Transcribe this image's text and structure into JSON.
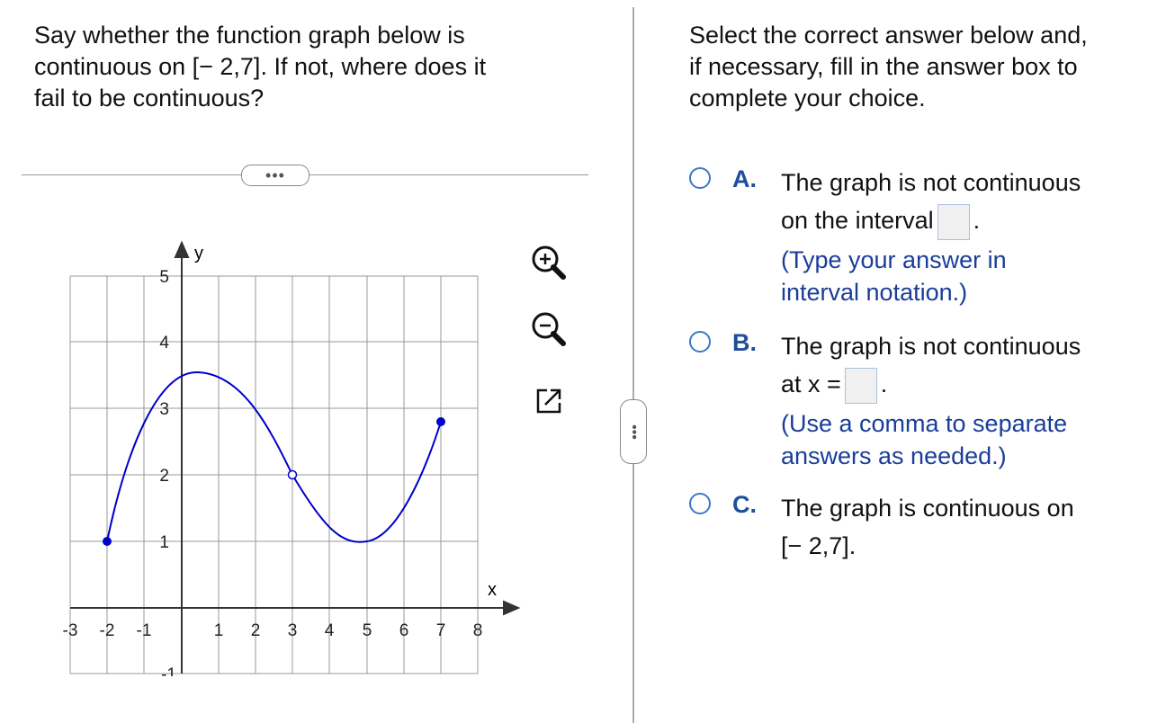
{
  "question": {
    "line1": "Say whether the function graph below is",
    "line2": "continuous on [− 2,7]. If not, where does it",
    "line3": "fail to be continuous?"
  },
  "more_label": "•••",
  "graph": {
    "x_axis_label": "x",
    "y_axis_label": "y",
    "x_ticks": [
      "-3",
      "-2",
      "-1",
      "1",
      "2",
      "3",
      "4",
      "5",
      "6",
      "7",
      "8"
    ],
    "y_ticks": [
      "-1",
      "1",
      "2",
      "3",
      "4",
      "5"
    ],
    "curve_color": "#0000cc",
    "grid_color": "#999999",
    "points": {
      "start_closed": {
        "x": -2,
        "y": 1
      },
      "hole_open": {
        "x": 3,
        "y": 2
      },
      "end_closed": {
        "x": 7,
        "y": 2.8
      }
    }
  },
  "tools": [
    "zoom-in-icon",
    "zoom-out-icon",
    "popout-icon"
  ],
  "side_handle_label": "•••",
  "instructions": {
    "line1": "Select the correct answer below and,",
    "line2": "if necessary, fill in the answer box to",
    "line3": "complete your choice."
  },
  "choices": [
    {
      "letter": "A.",
      "line1": "The graph is not continuous",
      "line2": "on the interval",
      "line2_after": ".",
      "note1": "(Type your answer in",
      "note2": "interval notation.)"
    },
    {
      "letter": "B.",
      "line1": "The graph is not continuous",
      "line2": "at x =",
      "line2_after": ".",
      "note1": "(Use a comma to separate",
      "note2": "answers as needed.)"
    },
    {
      "letter": "C.",
      "line1": "The graph is continuous on",
      "line2": "[− 2,7]."
    }
  ],
  "colors": {
    "accent": "#3b78c4",
    "letter": "#1f4e9c",
    "note": "#1a3d9a"
  }
}
